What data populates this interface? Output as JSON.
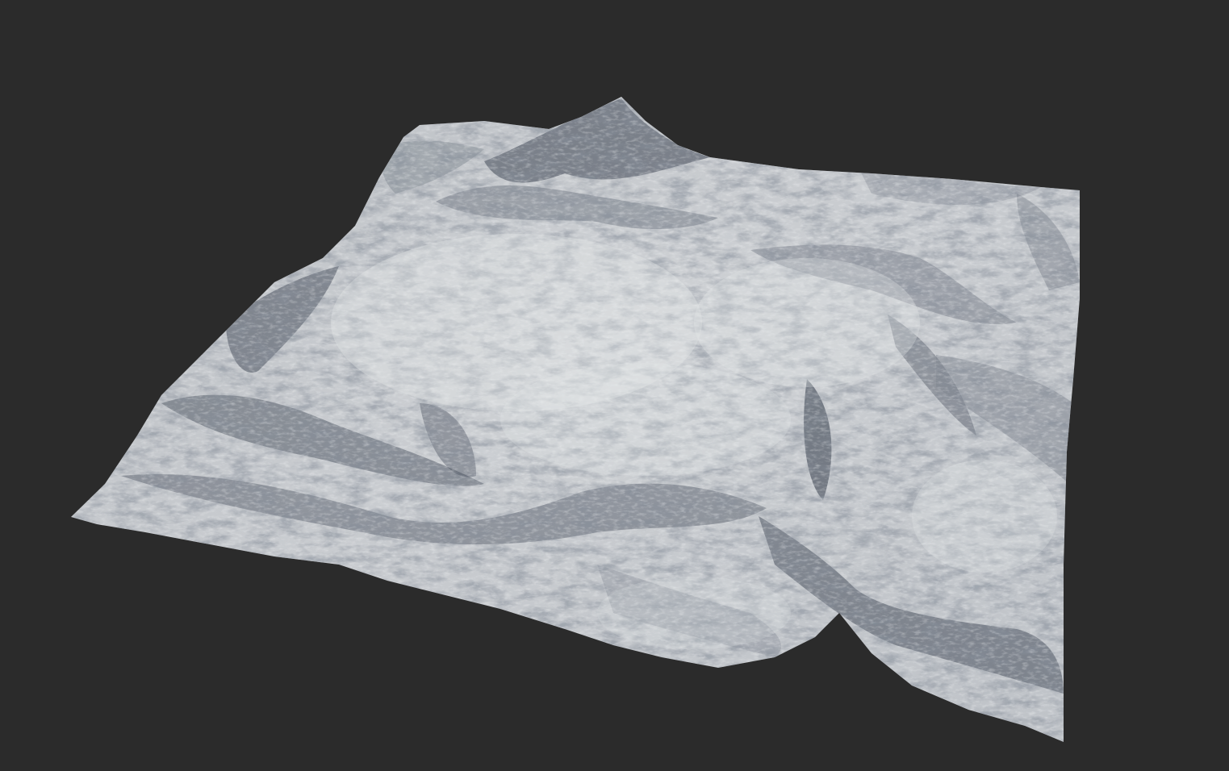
{
  "viewport": {
    "background_color": "#2b2b2b"
  },
  "terrain": {
    "surface_color": "#c4c7cb",
    "highlight_color": "#e8eaec",
    "shadow_color": "#3c4452",
    "mid_shadow_color": "#7d848e"
  }
}
